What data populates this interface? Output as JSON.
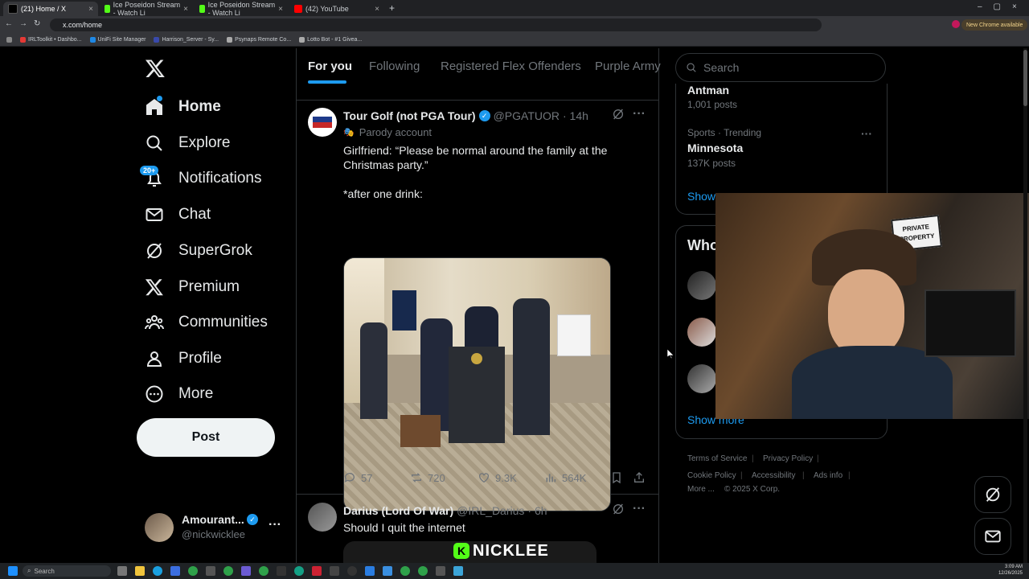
{
  "browser": {
    "tabs": [
      {
        "title": "(21) Home / X",
        "active": true
      },
      {
        "title": "Ice Poseidon Stream - Watch Li",
        "active": false
      },
      {
        "title": "Ice Poseidon Stream - Watch Li",
        "active": false
      },
      {
        "title": "(42) YouTube",
        "active": false
      }
    ],
    "url": "x.com/home",
    "update_label": "New Chrome available",
    "bookmarks": [
      "IRLToolkit • Dashbo...",
      "UniFi Site Manager",
      "Harrison_Server - Sy...",
      "Psynaps Remote Co...",
      "Lotto Bot - #1 Givea..."
    ]
  },
  "nav": {
    "items": [
      {
        "label": "Home",
        "icon": "home-icon"
      },
      {
        "label": "Explore",
        "icon": "search-icon"
      },
      {
        "label": "Notifications",
        "icon": "bell-icon",
        "badge": "20+"
      },
      {
        "label": "Chat",
        "icon": "mail-icon"
      },
      {
        "label": "SuperGrok",
        "icon": "grok-icon"
      },
      {
        "label": "Premium",
        "icon": "x-logo-icon"
      },
      {
        "label": "Communities",
        "icon": "people-icon"
      },
      {
        "label": "Profile",
        "icon": "person-icon"
      },
      {
        "label": "More",
        "icon": "more-circle-icon"
      }
    ],
    "post_label": "Post",
    "account": {
      "name": "Amourant...",
      "handle": "@nickwicklee"
    }
  },
  "feed": {
    "tabs": [
      "For you",
      "Following",
      "Registered Flex Offenders",
      "Purple Army"
    ],
    "tweets": [
      {
        "name": "Tour Golf (not PGA Tour)",
        "handle": "@PGATUOR",
        "time": "· 14h",
        "label": "Parody account",
        "text_line1": "Girlfriend: “Please be normal around the family at the",
        "text_line2": "Christmas party.”",
        "text_line3": "*after one drink:",
        "replies": "57",
        "reposts": "720",
        "likes": "9.3K",
        "views": "564K"
      },
      {
        "name": "Darius (Lord Of War)",
        "handle": "@IRL_Darius",
        "time": "· 6h",
        "text": "Should I quit the internet"
      }
    ]
  },
  "sidebar": {
    "search_placeholder": "Search",
    "trend_top_name": "Antman",
    "trend_top_posts": "1,001 posts",
    "trend2_category": "Sports · Trending",
    "trend2_name": "Minnesota",
    "trend2_posts": "137K posts",
    "show_more_partial": "Show",
    "who_title": "Who",
    "show_more": "Show more",
    "footer": [
      "Terms of Service",
      "Privacy Policy",
      "Cookie Policy",
      "Accessibility",
      "Ads info",
      "More ...",
      "© 2025 X Corp."
    ]
  },
  "overlay": {
    "streamer_tag": "NICKLEE",
    "sign_text": "PRIVATE PROPERTY"
  },
  "taskbar": {
    "search": "Search",
    "time": "3:09 AM",
    "date": "12/26/2025"
  },
  "colors": {
    "accent": "#1d9bf0",
    "verified": "#1d9bf0",
    "kick_green": "#53fc18"
  }
}
